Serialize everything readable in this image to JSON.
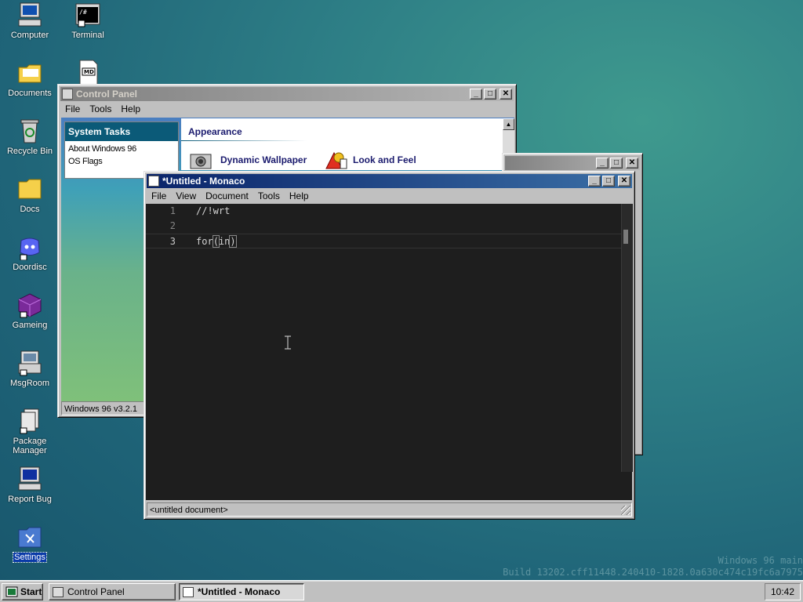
{
  "desktop": {
    "icons": [
      {
        "label": "Computer"
      },
      {
        "label": "Terminal"
      },
      {
        "label": "Documents"
      },
      {
        "label": "Recycle Bin"
      },
      {
        "label": "Docs"
      },
      {
        "label": "Doordisc"
      },
      {
        "label": "Gameing"
      },
      {
        "label": "MsgRoom"
      },
      {
        "label": "Package Manager"
      },
      {
        "label": "Report Bug"
      },
      {
        "label": "Settings"
      }
    ],
    "file_icon_label": "MD"
  },
  "control_panel": {
    "title": "Control Panel",
    "menu": [
      "File",
      "Tools",
      "Help"
    ],
    "sidebar": {
      "header": "System Tasks",
      "items": [
        "About Windows 96",
        "OS Flags"
      ]
    },
    "section": "Appearance",
    "options": [
      "Dynamic Wallpaper",
      "Look and Feel"
    ],
    "status": "Windows 96 v3.2.1"
  },
  "editor": {
    "title": "*Untitled - Monaco",
    "menu": [
      "File",
      "View",
      "Document",
      "Tools",
      "Help"
    ],
    "lines": [
      {
        "num": "1",
        "code": "//!wrt"
      },
      {
        "num": "2",
        "code": ""
      },
      {
        "num": "3",
        "code_before": "for",
        "code_bracket_open": "(",
        "code_mid": "in",
        "code_bracket_close": ")"
      }
    ],
    "status": "<untitled document>"
  },
  "window_buttons": {
    "minimize": "_",
    "maximize": "□",
    "close": "✕"
  },
  "taskbar": {
    "start_label": "Start",
    "tasks": [
      "Control Panel",
      "*Untitled - Monaco"
    ],
    "clock": "10:42"
  },
  "watermark": {
    "line1": "Windows 96 main",
    "line2": "Build 13202.cff11448.240410-1828.0a630c474c19fc6a7975"
  }
}
